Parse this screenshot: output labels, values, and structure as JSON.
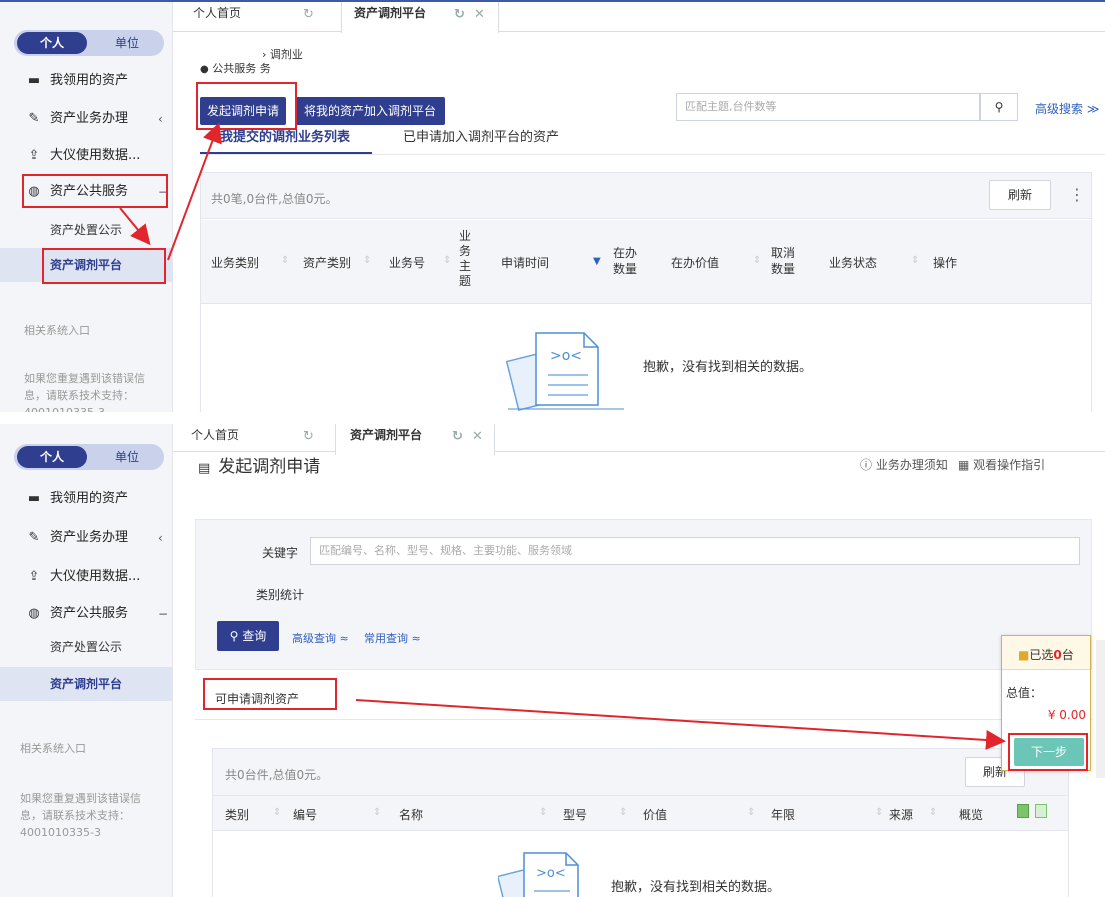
{
  "sidebar": {
    "seg_personal": "个人",
    "seg_unit": "单位",
    "items": [
      {
        "label": "我领用的资产",
        "icon": "laptop-icon"
      },
      {
        "label": "资产业务办理",
        "icon": "pencil-icon",
        "chev": "‹"
      },
      {
        "label": "大仪使用数据...",
        "icon": "upload-icon"
      },
      {
        "label": "资产公共服务",
        "icon": "globe-icon",
        "chev": "−"
      }
    ],
    "sub_items": [
      "资产处置公示",
      "资产调剂平台"
    ],
    "related": "相关系统入口",
    "support_1": "如果您重复遇到该错误信",
    "support_2": "息，请联系技术支持：",
    "support_3": "4001010335-3"
  },
  "tabs": {
    "home": "个人首页",
    "current": "资产调剂平台",
    "refresh_icon": "↻",
    "close_icon": "✕"
  },
  "panel1": {
    "breadcrumb_top": "› 调剂业",
    "breadcrumb_bottom": "公共服务 务",
    "btn_apply": "发起调剂申请",
    "btn_add": "将我的资产加入调剂平台",
    "search_placeholder": "匹配主题,台件数等",
    "advanced": "高级搜索 ≫",
    "subtab_active": "我提交的调剂业务列表",
    "subtab_other": "已申请加入调剂平台的资产",
    "summary": "共0笔,0台件,总值0元。",
    "refresh": "刷新",
    "more": "⋮",
    "columns": [
      "业务类别",
      "资产类别",
      "业务号",
      "业务主题",
      "申请时间",
      "在办数量",
      "在办价值",
      "取消数量",
      "业务状态",
      "操作"
    ],
    "empty": "抱歉，没有找到相关的数据。"
  },
  "panel2": {
    "title": "发起调剂申请",
    "help": "业务办理须知",
    "guide": "观看操作指引",
    "keyword_label": "关键字",
    "keyword_placeholder": "匹配编号、名称、型号、规格、主要功能、服务领域",
    "category_stats": "类别统计",
    "query_btn": "查询",
    "advanced_query": "高级查询 ≈",
    "common_query": "常用查询 ≈",
    "section_title": "可申请调剂资产",
    "summary": "共0台件,总值0元。",
    "refresh": "刷新",
    "columns": [
      "类别",
      "编号",
      "名称",
      "型号",
      "价值",
      "年限",
      "来源",
      "概览"
    ],
    "empty": "抱歉，没有找到相关的数据。",
    "cart_selected_prefix": "已选",
    "cart_count": "0",
    "cart_suffix": "台",
    "cart_total_label": "总值：",
    "cart_total": "¥ 0.00",
    "next_btn": "下一步"
  }
}
